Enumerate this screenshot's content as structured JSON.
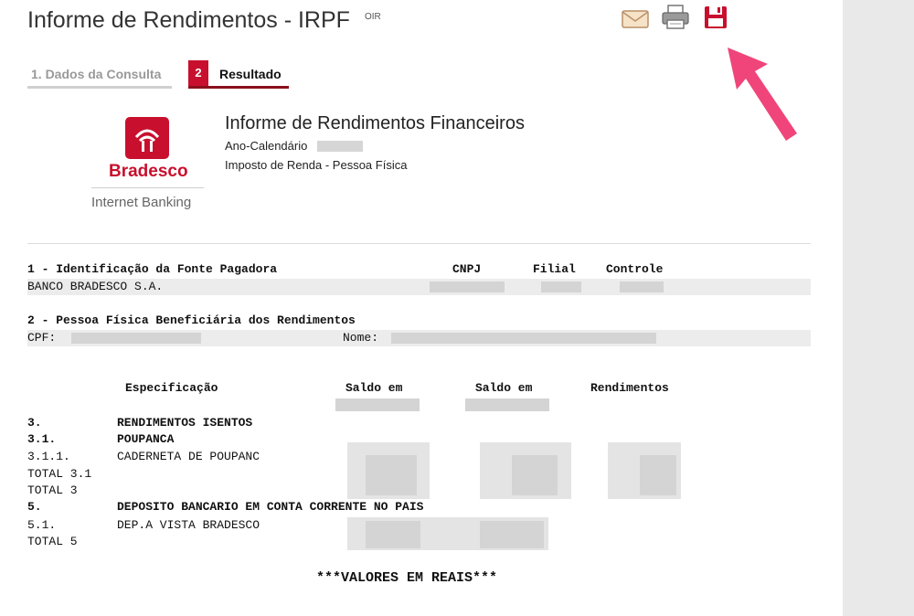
{
  "header": {
    "title": "Informe de Rendimentos - IRPF",
    "badge": "OIR",
    "icons": [
      "email-icon",
      "print-icon",
      "save-icon"
    ]
  },
  "steps": [
    {
      "label": "1. Dados da Consulta"
    },
    {
      "number": "2",
      "label": "Resultado"
    }
  ],
  "logo": {
    "name": "Bradesco",
    "subtitle": "Internet Banking",
    "color": "#c8102e"
  },
  "report": {
    "title": "Informe de Rendimentos Financeiros",
    "year_label": "Ano-Calendário",
    "subtitle": "Imposto de Renda - Pessoa Física"
  },
  "section1": {
    "heading": "1 - Identificação da Fonte Pagadora",
    "cnpj_label": "CNPJ",
    "filial_label": "Filial",
    "controle_label": "Controle",
    "payer": "BANCO BRADESCO S.A."
  },
  "section2": {
    "heading": "2 - Pessoa Física Beneficiária dos Rendimentos",
    "cpf_label": "CPF:",
    "nome_label": "Nome:"
  },
  "table": {
    "headers": [
      "Especificação",
      "Saldo em",
      "Saldo em",
      "Rendimentos"
    ],
    "rows": [
      {
        "code": "3.",
        "desc": "RENDIMENTOS ISENTOS",
        "bold": true
      },
      {
        "code": "3.1.",
        "desc": "POUPANCA",
        "bold": true
      },
      {
        "code": "3.1.1.",
        "desc": "CADERNETA DE POUPANC",
        "bold": false
      },
      {
        "code": "TOTAL 3.1",
        "desc": "",
        "bold": false
      },
      {
        "code": "TOTAL 3",
        "desc": "",
        "bold": false
      },
      {
        "code": "5.",
        "desc": "DEPOSITO BANCARIO EM CONTA CORRENTE NO PAIS",
        "bold": true
      },
      {
        "code": "5.1.",
        "desc": "DEP.A VISTA BRADESCO",
        "bold": false
      },
      {
        "code": "TOTAL 5",
        "desc": "",
        "bold": false
      }
    ]
  },
  "footer": "***VALORES EM REAIS***"
}
